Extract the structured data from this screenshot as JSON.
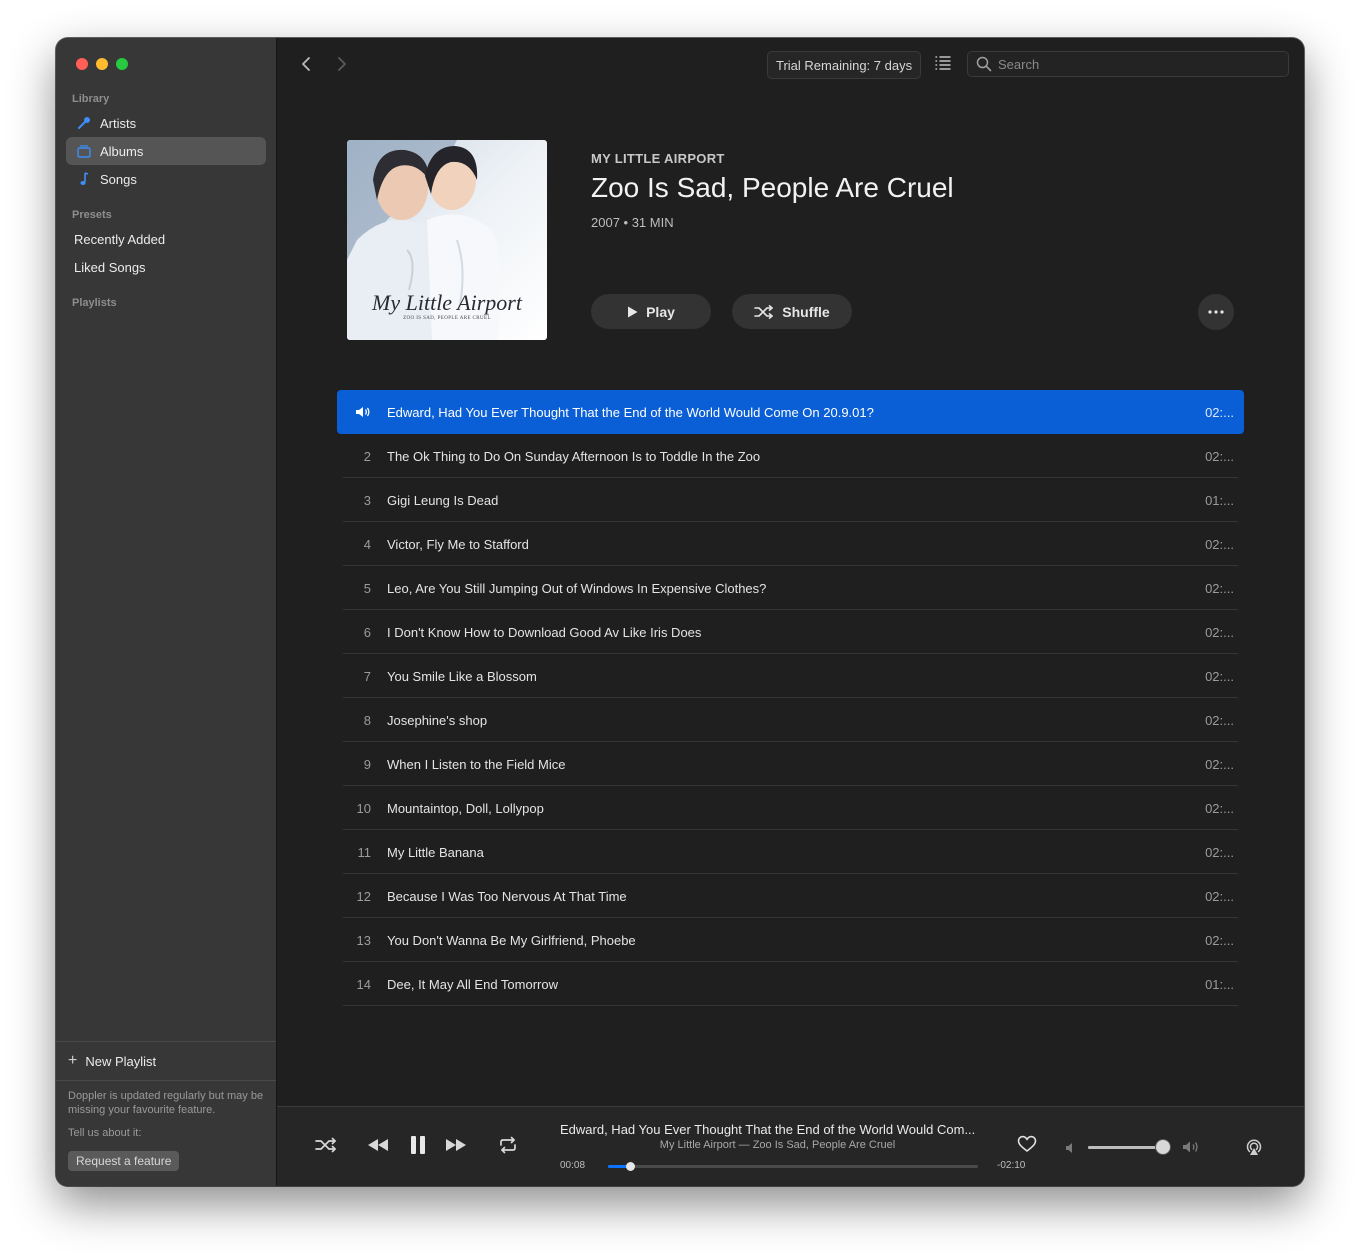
{
  "sidebar": {
    "library_label": "Library",
    "library_items": [
      "Artists",
      "Albums",
      "Songs"
    ],
    "presets_label": "Presets",
    "preset_items": [
      "Recently Added",
      "Liked Songs"
    ],
    "playlists_label": "Playlists",
    "new_playlist_label": "New Playlist",
    "note": "Doppler is updated regularly but may be missing your favourite feature.",
    "tell_us": "Tell us about it:",
    "request_button": "Request a feature",
    "active_item": "Albums"
  },
  "toolbar": {
    "trial": "Trial Remaining: 7 days",
    "search_placeholder": "Search"
  },
  "album": {
    "artist": "MY LITTLE AIRPORT",
    "title": "Zoo Is Sad, People Are Cruel",
    "meta": "2007 • 31 MIN",
    "cover_text": "My Little Airport",
    "cover_subtext": "ZOO IS SAD, PEOPLE ARE CRUEL",
    "play_label": "Play",
    "shuffle_label": "Shuffle"
  },
  "tracks": [
    {
      "num": "1",
      "title": "Edward, Had You Ever Thought That the End of the World Would Come On 20.9.01?",
      "duration": "02:...",
      "playing": true
    },
    {
      "num": "2",
      "title": "The Ok Thing to Do On Sunday Afternoon Is to Toddle In the Zoo",
      "duration": "02:..."
    },
    {
      "num": "3",
      "title": "Gigi Leung Is Dead",
      "duration": "01:..."
    },
    {
      "num": "4",
      "title": "Victor, Fly Me to Stafford",
      "duration": "02:..."
    },
    {
      "num": "5",
      "title": "Leo, Are You Still Jumping Out of Windows In Expensive Clothes?",
      "duration": "02:..."
    },
    {
      "num": "6",
      "title": "I Don't Know How to Download Good Av Like Iris Does",
      "duration": "02:..."
    },
    {
      "num": "7",
      "title": "You Smile Like a Blossom",
      "duration": "02:..."
    },
    {
      "num": "8",
      "title": "Josephine's shop",
      "duration": "02:..."
    },
    {
      "num": "9",
      "title": "When I Listen to the Field Mice",
      "duration": "02:..."
    },
    {
      "num": "10",
      "title": "Mountaintop, Doll, Lollypop",
      "duration": "02:..."
    },
    {
      "num": "11",
      "title": "My Little Banana",
      "duration": "02:..."
    },
    {
      "num": "12",
      "title": "Because I Was Too Nervous At That Time",
      "duration": "02:..."
    },
    {
      "num": "13",
      "title": "You Don't Wanna Be My Girlfriend, Phoebe",
      "duration": "02:..."
    },
    {
      "num": "14",
      "title": "Dee, It May All End Tomorrow",
      "duration": "01:..."
    }
  ],
  "now_playing": {
    "title": "Edward, Had You Ever Thought That the End of the World Would Com...",
    "subtitle": "My Little Airport — Zoo Is Sad, People Are Cruel",
    "elapsed": "00:08",
    "remaining": "-02:10",
    "progress_fraction": 0.06,
    "volume_fraction": 0.99
  },
  "colors": {
    "accent": "#0a5fd6",
    "traffic_red": "#ff5f57",
    "traffic_yellow": "#febc2e",
    "traffic_green": "#28c840"
  }
}
